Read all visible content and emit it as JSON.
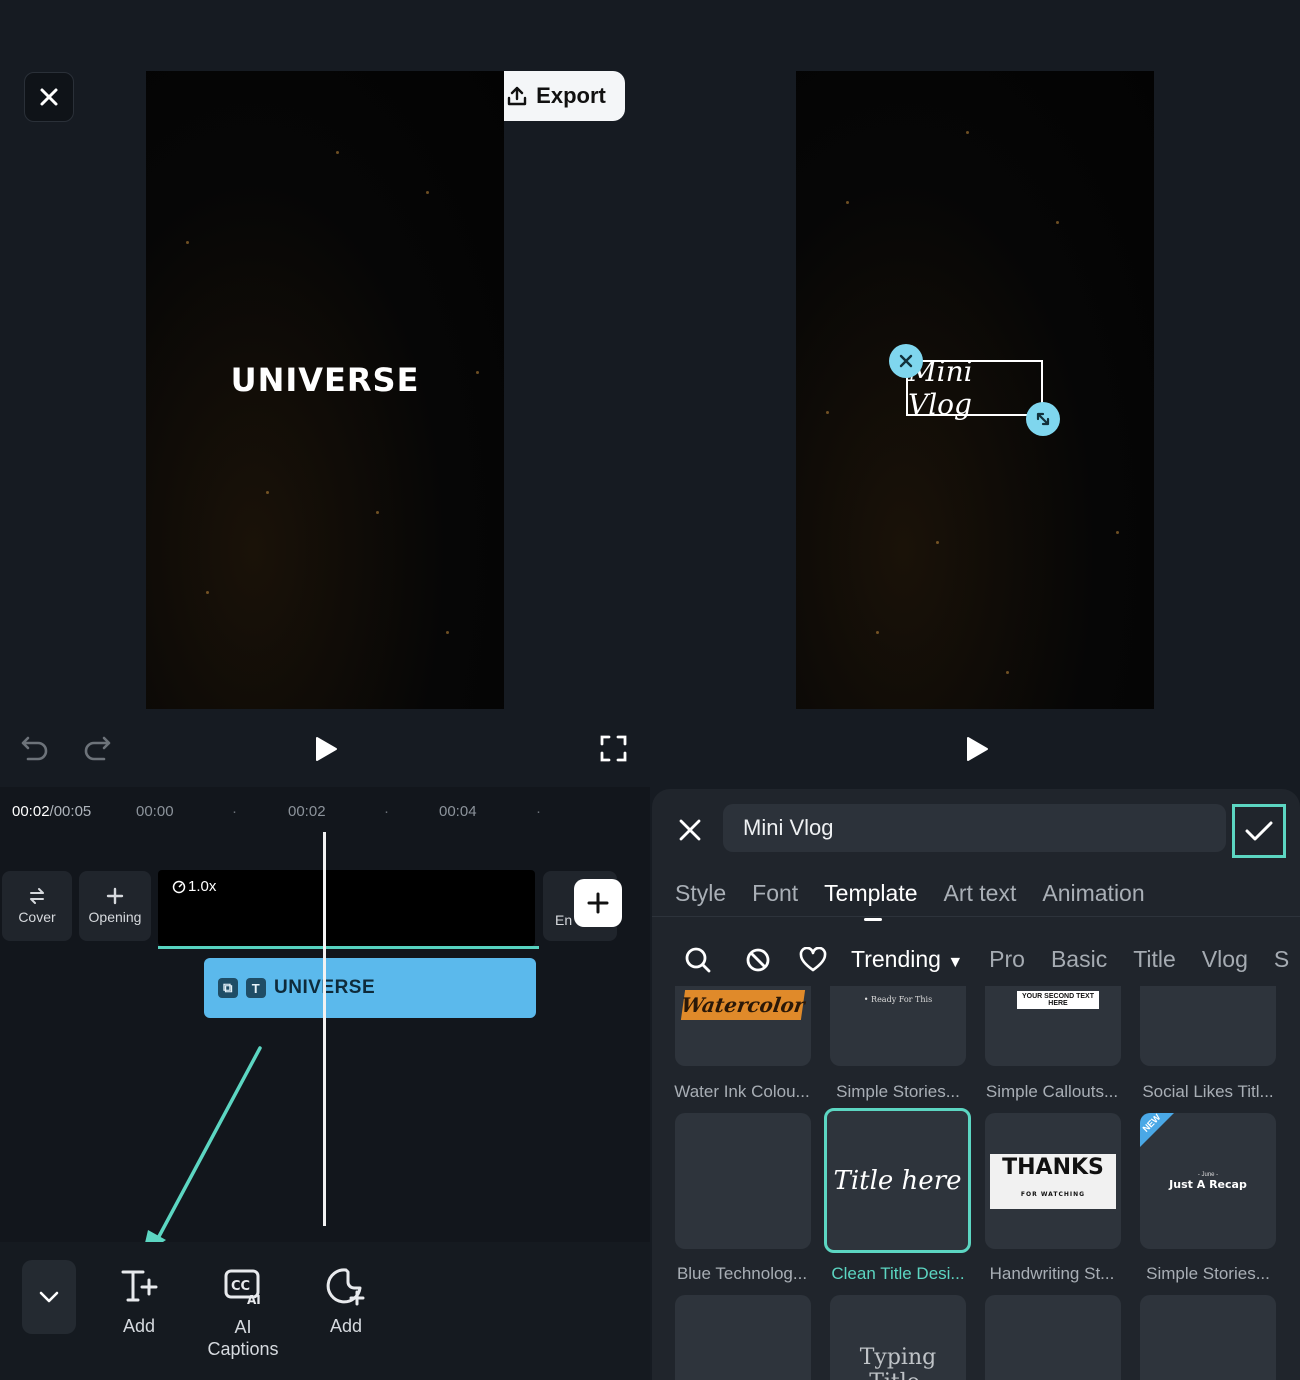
{
  "top": {
    "export_label": "Export"
  },
  "preview_left": {
    "overlay_text": "UNIVERSE"
  },
  "preview_right": {
    "overlay_text": "Mini Vlog"
  },
  "timeline": {
    "current_time": "00:02",
    "total_time": "/00:05",
    "ruler": [
      "00:00",
      "00:02",
      "00:04"
    ],
    "cover_label": "Cover",
    "opening_label": "Opening",
    "ending_label": "En",
    "clip_speed": "1.0x",
    "text_clip_label": "UNIVERSE",
    "text_clip_chip": "T"
  },
  "bottom_tools": [
    {
      "label": "Add"
    },
    {
      "label": "AI\nCaptions",
      "line1": "AI",
      "line2": "Captions"
    },
    {
      "label": "Add"
    }
  ],
  "panel": {
    "search_value": "Mini Vlog",
    "tabs": [
      "Style",
      "Font",
      "Template",
      "Art text",
      "Animation"
    ],
    "active_tab": "Template",
    "filters": [
      "Trending",
      "Pro",
      "Basic",
      "Title",
      "Vlog",
      "S"
    ],
    "selected_filter": "Trending",
    "templates": [
      {
        "label": "Water Ink Colou...",
        "preview": "Watercolor"
      },
      {
        "label": "Simple Stories...",
        "preview": "• Ready For This"
      },
      {
        "label": "Simple Callouts...",
        "preview": "YOUR SECOND TEXT HERE"
      },
      {
        "label": "Social Likes Titl...",
        "preview": ""
      },
      {
        "label": "Blue Technolog...",
        "preview": ""
      },
      {
        "label": "Clean Title Desi...",
        "preview": "Title here",
        "selected": true
      },
      {
        "label": "Handwriting St...",
        "preview": "THANKS",
        "sub": "FOR WATCHING"
      },
      {
        "label": "Simple Stories...",
        "preview": "Just A Recap",
        "sub": "- June -",
        "badge": "NEW"
      },
      {
        "label": "",
        "preview": ""
      },
      {
        "label": "",
        "preview": "Typing Title."
      },
      {
        "label": "",
        "preview": ""
      },
      {
        "label": "",
        "preview": ""
      }
    ]
  },
  "colors": {
    "accent": "#5cd6c2",
    "clip_blue": "#5bb9ec",
    "panel_bg": "#20252c"
  }
}
